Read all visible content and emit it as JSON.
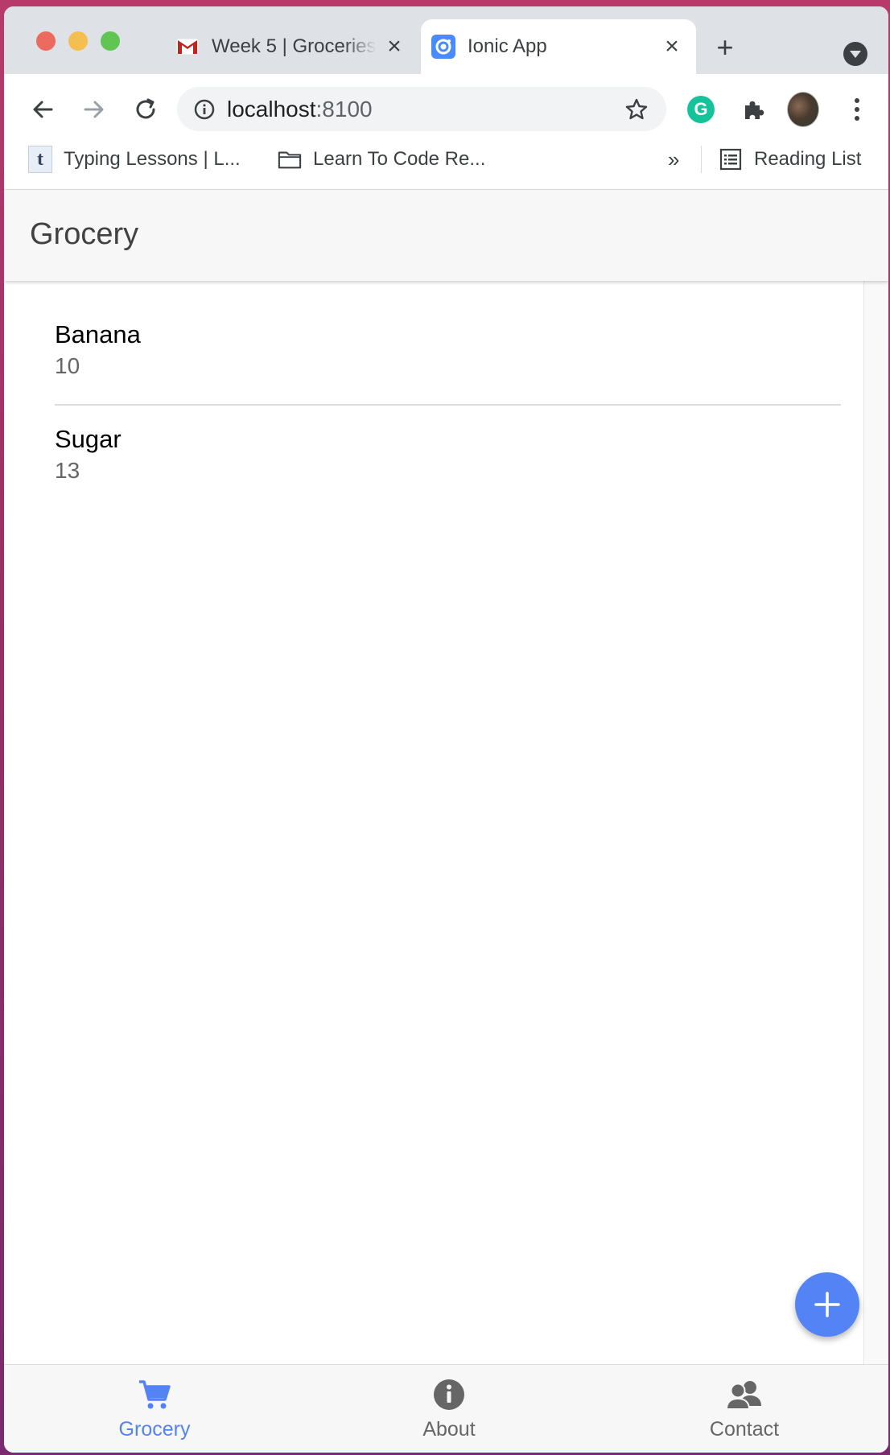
{
  "browser": {
    "tabs": [
      {
        "title": "Week 5 | Groceries",
        "favicon": "gmail-m-icon"
      },
      {
        "title": "Ionic App",
        "favicon": "ionic-icon",
        "active": true
      }
    ],
    "address": {
      "host": "localhost",
      "port": ":8100"
    },
    "bookmarks": [
      {
        "label": "Typing Lessons | L...",
        "icon": "tumblr-t-icon"
      },
      {
        "label": "Learn To Code Re...",
        "icon": "folder-icon"
      }
    ],
    "more_bookmarks": "»",
    "reading_list": "Reading List",
    "extension_grammarly": "G"
  },
  "app": {
    "title": "Grocery",
    "items": [
      {
        "name": "Banana",
        "quantity": "10"
      },
      {
        "name": "Sugar",
        "quantity": "13"
      }
    ],
    "tabs": [
      {
        "label": "Grocery",
        "icon": "cart-icon",
        "selected": true
      },
      {
        "label": "About",
        "icon": "info-icon",
        "selected": false
      },
      {
        "label": "Contact",
        "icon": "people-icon",
        "selected": false
      }
    ]
  },
  "colors": {
    "accent": "#5383f4",
    "header_bg": "#f7f7f7",
    "tab_inactive": "#666666"
  }
}
